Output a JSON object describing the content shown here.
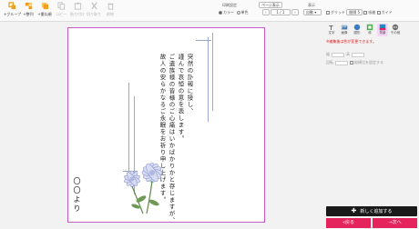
{
  "toolbar": {
    "left_tools": [
      {
        "label": "+グループ"
      },
      {
        "label": "+整列"
      },
      {
        "label": "+重ね順"
      },
      {
        "label": "コピー"
      },
      {
        "label": "貼り付け"
      },
      {
        "label": "切り取り"
      },
      {
        "label": "削除"
      }
    ],
    "display_setting_label": "印刷設定",
    "color_radio": "カラー",
    "mono_radio": "単色",
    "page_button": "ページ表示",
    "page_indicator": "1 / 1",
    "zoom_label": "表示",
    "zoom_value": "自動",
    "grid_checkbox": "グリッド",
    "grid_interval": "間隔 5",
    "snap_checkbox": "吸着",
    "guide_checkbox": "ガイド"
  },
  "card": {
    "message_lines": [
      "突然の訃報に接し、",
      "謹んで哀悼の意を表します。",
      "ご遺族様の皆様のご心痛はいかばかりかと存じますが、",
      "故人の安らかなるご永眠をお祈り申し上げます。"
    ],
    "signature": "〇〇より"
  },
  "panel": {
    "tools": [
      {
        "label": "文字"
      },
      {
        "label": "画像"
      },
      {
        "label": "図形"
      },
      {
        "label": "枠"
      },
      {
        "label": "背景"
      },
      {
        "label": "その他"
      }
    ],
    "warning": "※編集後は色が変更できます。",
    "row1_label": "幅",
    "row1_mid": "高",
    "row2_label": "回転",
    "row2_text": "縦横比を固定する"
  },
  "actions": {
    "add_new": "新しく追加する",
    "back": "戻る",
    "next": "次へ"
  },
  "colors": {
    "accent": "#e5245d",
    "card_border": "#c45bc4",
    "frame_lines": "#9aa6d4",
    "add_button": "#1a1a1a"
  }
}
